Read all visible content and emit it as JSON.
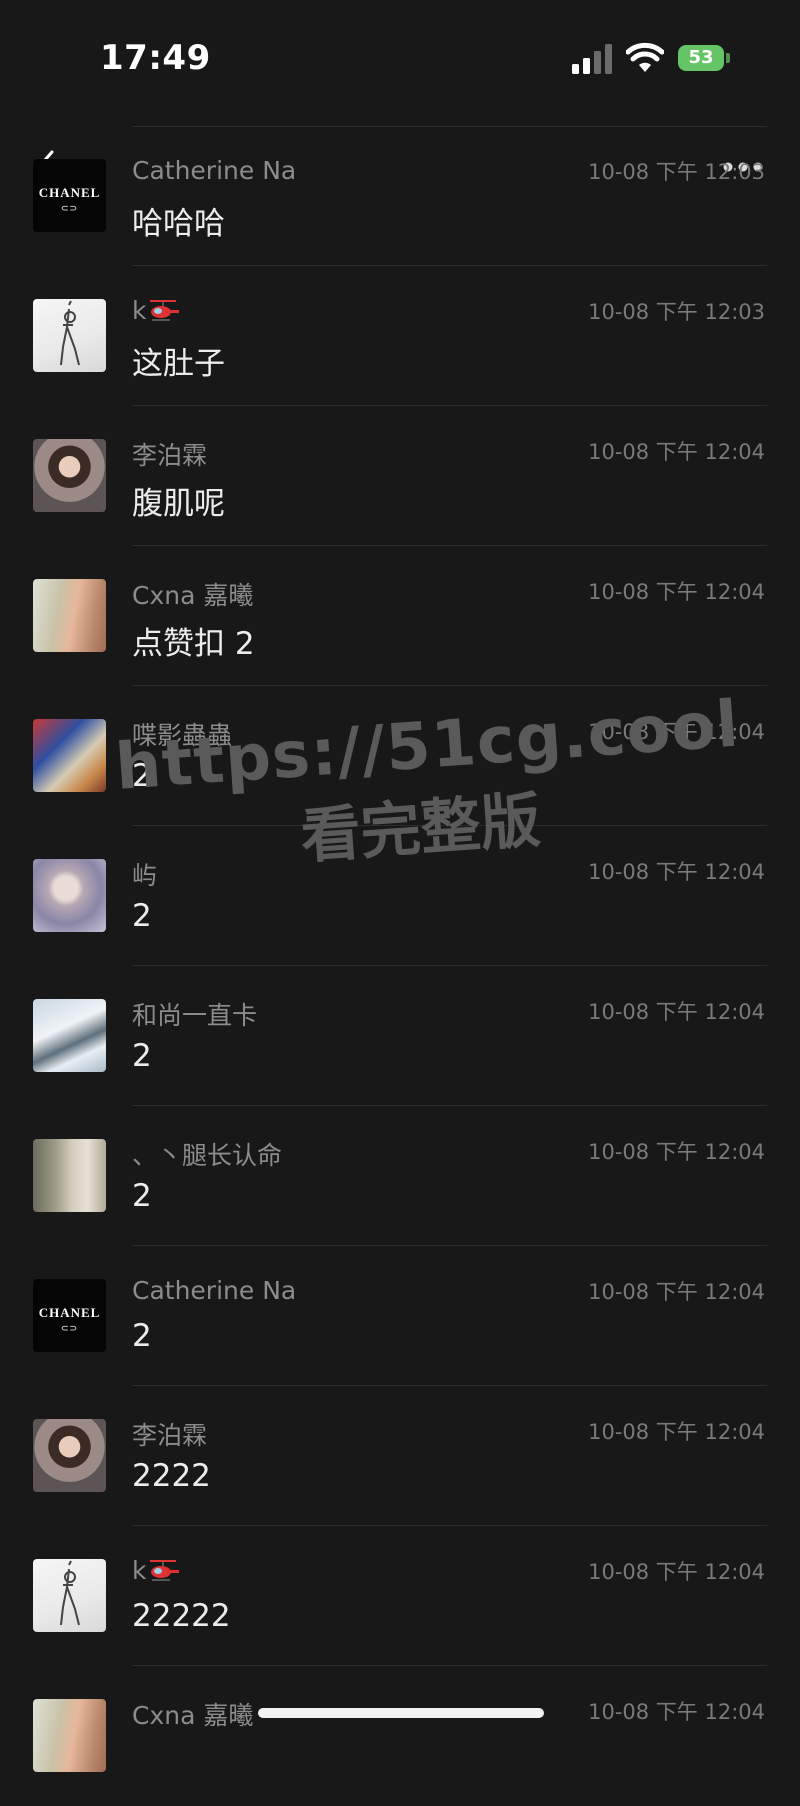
{
  "status_bar": {
    "time": "17:49",
    "battery": "53"
  },
  "nav": {
    "back_icon": "chevron-left-icon",
    "more_icon": "ellipsis-icon"
  },
  "comments": [
    {
      "name": "Catherine Na",
      "name_icon": null,
      "time": "10-08 下午 12:03",
      "text": "哈哈哈",
      "avatar": "chanel-logo"
    },
    {
      "name": "k",
      "name_icon": "helicopter-emoji",
      "time": "10-08 下午 12:03",
      "text": "这肚子",
      "avatar": "sketch-figure"
    },
    {
      "name": "李泊霖",
      "name_icon": null,
      "time": "10-08 下午 12:04",
      "text": "腹肌呢",
      "avatar": "portrait-girl"
    },
    {
      "name": "Cxna 嘉曦",
      "name_icon": null,
      "time": "10-08 下午 12:04",
      "text": "点赞扣 2",
      "avatar": "cat-and-girl"
    },
    {
      "name": "喋影蟲蟲",
      "name_icon": null,
      "time": "10-08 下午 12:04",
      "text": "2",
      "avatar": "spiderman"
    },
    {
      "name": "屿",
      "name_icon": null,
      "time": "10-08 下午 12:04",
      "text": "2",
      "avatar": "soft-portrait"
    },
    {
      "name": "和尚一直卡",
      "name_icon": null,
      "time": "10-08 下午 12:04",
      "text": "2",
      "avatar": "skier"
    },
    {
      "name": "、丶腿长认命",
      "name_icon": null,
      "time": "10-08 下午 12:04",
      "text": "2",
      "avatar": "room-girl"
    },
    {
      "name": "Catherine Na",
      "name_icon": null,
      "time": "10-08 下午 12:04",
      "text": "2",
      "avatar": "chanel-logo"
    },
    {
      "name": "李泊霖",
      "name_icon": null,
      "time": "10-08 下午 12:04",
      "text": "2222",
      "avatar": "portrait-girl"
    },
    {
      "name": "k",
      "name_icon": "helicopter-emoji",
      "time": "10-08 下午 12:04",
      "text": "22222",
      "avatar": "sketch-figure"
    },
    {
      "name": "Cxna 嘉曦",
      "name_icon": null,
      "time": "10-08 下午 12:04",
      "text": "",
      "avatar": "cat-and-girl"
    }
  ],
  "chanel_logo_text": "CHANEL",
  "watermark": {
    "url": "https://51cg.cool",
    "text": "看完整版"
  }
}
